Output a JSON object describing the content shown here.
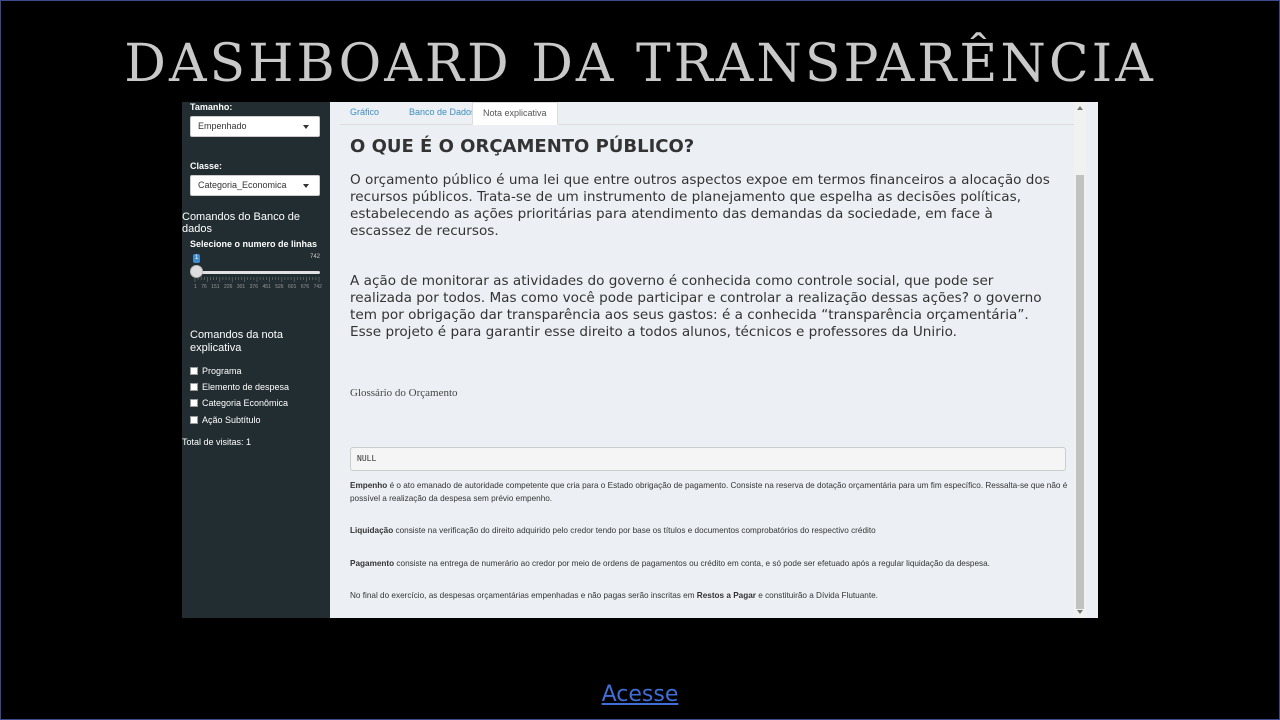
{
  "header": {
    "title": "DASHBOARD DA TRANSPARÊNCIA"
  },
  "sidebar": {
    "tamanho_label": "Tamanho:",
    "tamanho_value": "Empenhado",
    "classe_label": "Classe:",
    "classe_value": "Categoria_Economica",
    "db_commands_heading": "Comandos do Banco de dados",
    "rows_label": "Selecione o numero de linhas",
    "slider": {
      "min": "1",
      "max": "742",
      "value": "1",
      "tick_labels": [
        "1",
        "76",
        "151",
        "226",
        "301",
        "376",
        "451",
        "526",
        "601",
        "676",
        "742"
      ]
    },
    "note_heading": "Comandos da nota explicativa",
    "checkboxes": [
      "Programa",
      "Elemento de despesa",
      "Categoria Econômica",
      "Ação Subtítulo"
    ],
    "visits": "Total de visitas: 1"
  },
  "tabs": [
    "Gráfico",
    "Banco de Dados",
    "Nota explicativa"
  ],
  "content": {
    "heading": "O QUE É O ORÇAMENTO PÚBLICO?",
    "para1": "O orçamento público é uma lei que entre outros aspectos expoe em termos financeiros a alocação dos recursos públicos. Trata-se de um instrumento de planejamento que espelha as decisões políticas, estabelecendo as ações prioritárias para atendimento das demandas da sociedade, em face à escassez de recursos.",
    "para2": "A ação de monitorar as atividades do governo é conhecida como controle social, que pode ser realizada por todos. Mas como você pode participar e controlar a realização dessas ações? o governo tem por obrigação dar transparência aos seus gastos: é a conhecida “transparência orçamentária”. Esse projeto é para garantir esse direito a todos alunos, técnicos e professores da Unirio.",
    "glossary_title": "Glossário do Orçamento",
    "null_output": "NULL",
    "empenho_term": "Empenho",
    "empenho_text": " é o ato emanado de autoridade competente que cria para o Estado obrigação de pagamento. Consiste na reserva de dotação orçamentária para um fim específico. Ressalta-se que não é possível a realização da despesa sem prévio empenho.",
    "liquidacao_term": "Liquidação",
    "liquidacao_text": " consiste na verificação do direito adquirido pelo credor tendo por base os títulos e documentos comprobatórios do respectivo crédito",
    "pagamento_term": "Pagamento",
    "pagamento_text": " consiste na entrega de numerário ao credor por meio de ordens de pagamentos ou crédito em conta, e só pode ser efetuado após a regular liquidação da despesa.",
    "restos_pre": "No final do exercício, as despesas orçamentárias empenhadas e não pagas serão inscritas em ",
    "restos_term": "Restos a Pagar",
    "restos_post": " e constituirão a Dívida Flutuante."
  },
  "footer": {
    "link": "Acesse"
  },
  "colors": {
    "sidebar_bg": "#222d32",
    "content_bg": "#ecf0f5",
    "link": "#3f6ed6",
    "tab_link": "#3c8dbc"
  }
}
